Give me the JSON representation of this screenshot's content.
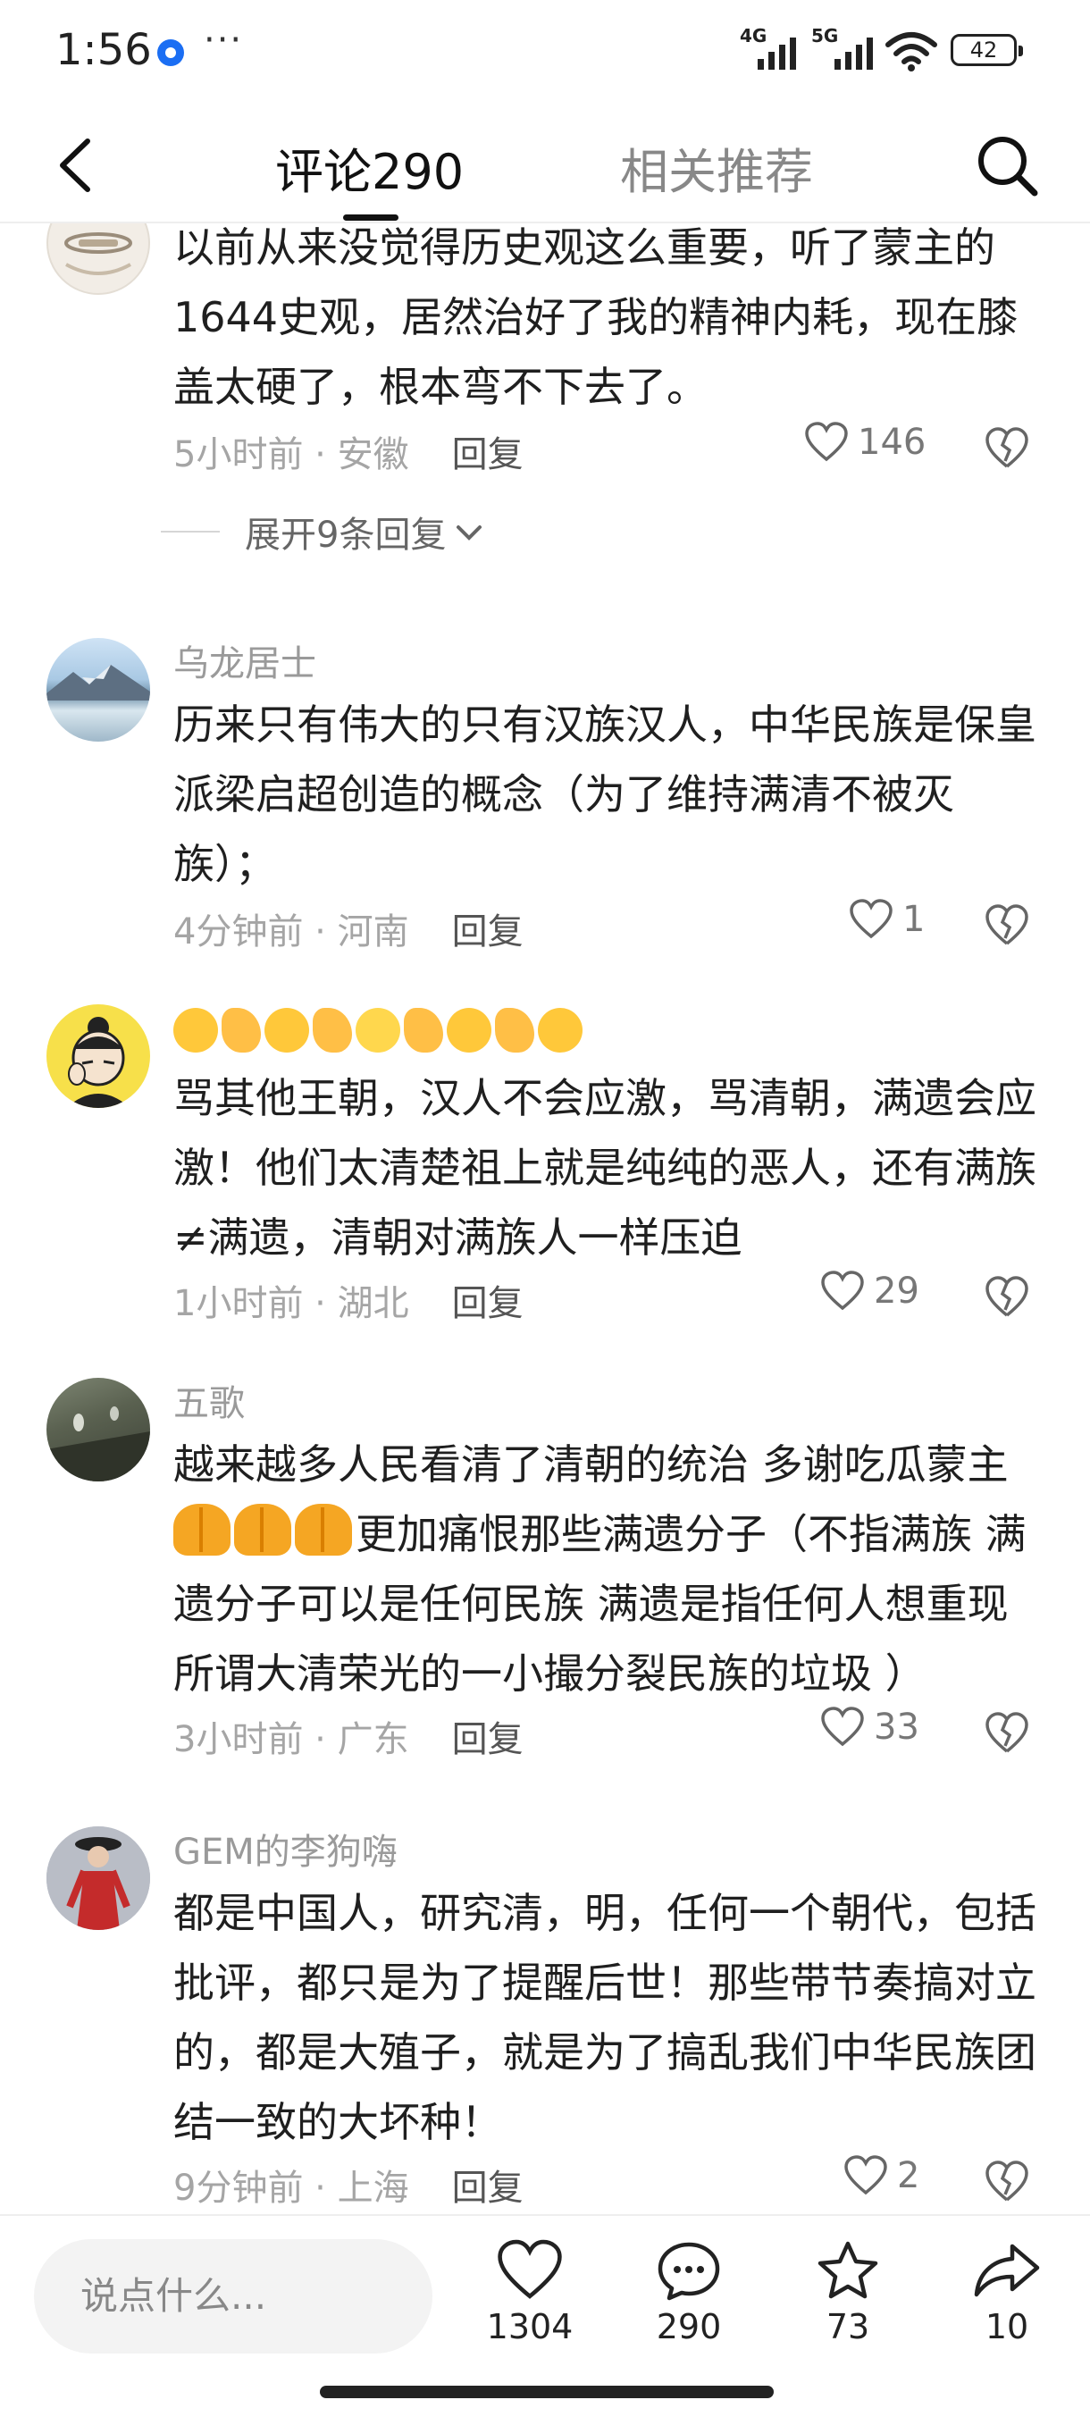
{
  "status": {
    "time": "1:56",
    "more": "···",
    "net1": "4G",
    "net2": "5G",
    "battery": "42"
  },
  "header": {
    "tabs": [
      {
        "label": "评论290",
        "active": true
      },
      {
        "label": "相关推荐",
        "active": false
      }
    ]
  },
  "comments": [
    {
      "user": "",
      "text": "以前从来没觉得历史观这么重要，听了蒙主的1644史观，居然治好了我的精神内耗，现在膝盖太硬了，根本弯不下去了。",
      "time": "5小时前",
      "location": "安徽",
      "reply": "回复",
      "likes": "146",
      "expand": "展开9条回复"
    },
    {
      "user": "乌龙居士",
      "text": "历来只有伟大的只有汉族汉人，中华民族是保皇派梁启超创造的概念（为了维持满清不被灭族）；",
      "time": "4分钟前",
      "location": "河南",
      "reply": "回复",
      "likes": "1"
    },
    {
      "user": "",
      "text": "骂其他王朝，汉人不会应激，骂清朝，满遗会应激！他们太清楚祖上就是纯纯的恶人，还有满族≠满遗，清朝对满族人一样压迫",
      "time": "1小时前",
      "location": "湖北",
      "reply": "回复",
      "likes": "29"
    },
    {
      "user": "五歌",
      "text_line1": "越来越多人民看清了清朝的统治 多谢吃瓜蒙主",
      "text_rest": "更加痛恨那些满遗分子（不指满族 满遗分子可以是任何民族 满遗是指任何人想重现所谓大清荣光的一小撮分裂民族的垃圾 ）",
      "time": "3小时前",
      "location": "广东",
      "reply": "回复",
      "likes": "33"
    },
    {
      "user": "GEM的李狗嗨",
      "text": "都是中国人，研究清，明，任何一个朝代，包括批评，都只是为了提醒后世！那些带节奏搞对立的，都是大殖子，就是为了搞乱我们中华民族团结一致的大坏种！",
      "time": "9分钟前",
      "location": "上海",
      "reply": "回复",
      "likes": "2"
    }
  ],
  "bottom": {
    "placeholder": "说点什么...",
    "likes": "1304",
    "comments": "290",
    "favorites": "73",
    "shares": "10"
  }
}
